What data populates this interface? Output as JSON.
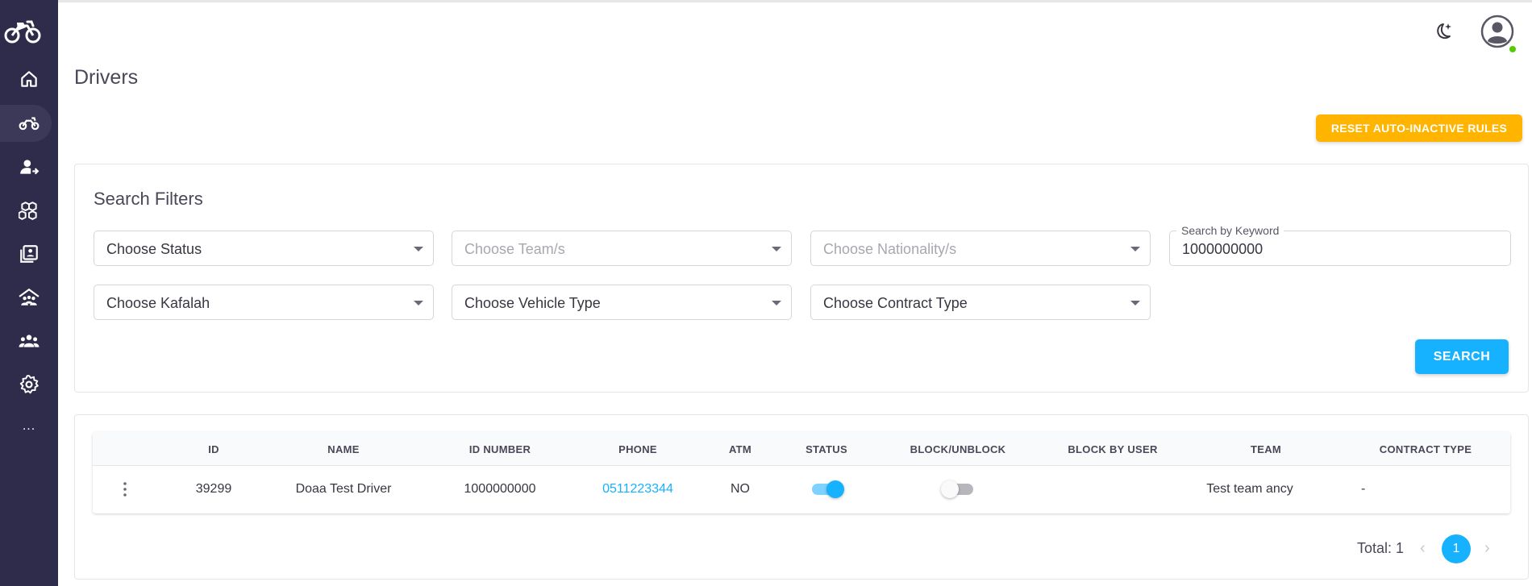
{
  "header": {
    "page_title": "Drivers",
    "theme_icon": "moon-icon",
    "avatar_icon": "user-avatar-icon",
    "online_color": "#56ca00"
  },
  "sidebar": {
    "bg_color": "#2f2b4a",
    "items": [
      {
        "icon": "home-icon",
        "active": false
      },
      {
        "icon": "motorcycle-icon",
        "active": true
      },
      {
        "icon": "user-assign-icon",
        "active": false
      },
      {
        "icon": "boxes-icon",
        "active": false
      },
      {
        "icon": "contacts-book-icon",
        "active": false
      },
      {
        "icon": "shelter-people-icon",
        "active": false
      },
      {
        "icon": "group-icon",
        "active": false
      },
      {
        "icon": "gear-icon",
        "active": false
      }
    ],
    "more_label": "..."
  },
  "actions": {
    "reset_label": "RESET AUTO-INACTIVE RULES",
    "reset_color": "#ffb400"
  },
  "filters": {
    "title": "Search Filters",
    "status": "Choose Status",
    "team": "Choose Team/s",
    "nationality": "Choose Nationality/s",
    "keyword_label": "Search by Keyword",
    "keyword_value": "1000000000",
    "kafalah": "Choose Kafalah",
    "vehicle_type": "Choose Vehicle Type",
    "contract_type": "Choose Contract Type",
    "search_label": "SEARCH",
    "accent_color": "#16b1ff"
  },
  "table": {
    "columns": [
      "",
      "ID",
      "NAME",
      "ID NUMBER",
      "PHONE",
      "ATM",
      "STATUS",
      "BLOCK/UNBLOCK",
      "BLOCK BY USER",
      "TEAM",
      "CONTRACT TYPE"
    ],
    "rows": [
      {
        "id": "39299",
        "name": "Doaa Test Driver",
        "id_number": "1000000000",
        "phone": "0511223344",
        "atm": "NO",
        "status_on": true,
        "blocked": false,
        "block_by_user": "",
        "team": "Test team ancy",
        "contract_type": "-"
      }
    ]
  },
  "pagination": {
    "total_label": "Total: 1",
    "current_page": "1",
    "prev_icon": "chevron-left-icon",
    "next_icon": "chevron-right-icon"
  }
}
